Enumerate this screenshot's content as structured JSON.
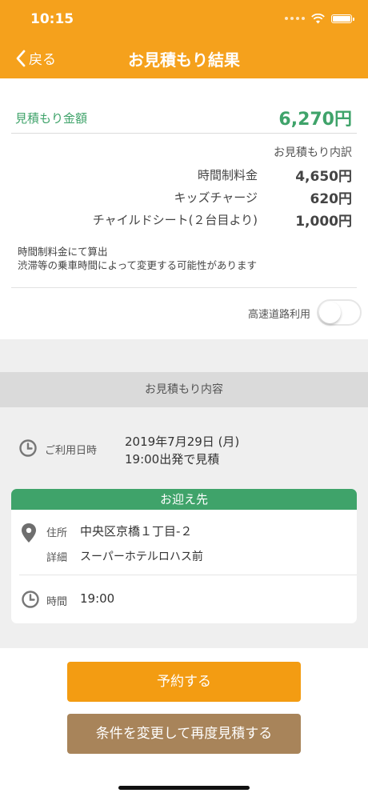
{
  "status_bar": {
    "time": "10:15"
  },
  "nav": {
    "back_label": "戻る",
    "title": "お見積もり結果"
  },
  "estimate": {
    "total_label": "見積もり金額",
    "total_value": "6,270円",
    "breakdown_title": "お見積もり内訳",
    "items": [
      {
        "label": "時間制料金",
        "value": "4,650円"
      },
      {
        "label": "キッズチャージ",
        "value": "620円"
      },
      {
        "label": "チャイルドシート(２台目より)",
        "value": "1,000円"
      }
    ],
    "notes": [
      "時間制料金にて算出",
      "渋滞等の乗車時間によって変更する可能性があります"
    ],
    "highway_label": "高速道路利用",
    "highway_enabled": false
  },
  "details": {
    "section_title": "お見積もり内容",
    "date_label": "ご利用日時",
    "date_value": "2019年7月29日 (月)",
    "departure": "19:00出発で見積"
  },
  "pickup": {
    "header": "お迎え先",
    "address_label": "住所",
    "address_value": "中央区京橋１丁目-２",
    "detail_label": "詳細",
    "detail_value": "スーパーホテルロハス前",
    "time_label": "時間",
    "time_value": "19:00"
  },
  "actions": {
    "reserve_label": "予約する",
    "requote_label": "条件を変更して再度見積する"
  },
  "colors": {
    "header": "#f5a11c",
    "green": "#3fa36a",
    "reserve": "#f39c12",
    "requote": "#a8845a"
  },
  "icons": [
    "chevron-left-icon",
    "wifi-icon",
    "battery-icon",
    "clock-icon",
    "map-pin-icon"
  ]
}
